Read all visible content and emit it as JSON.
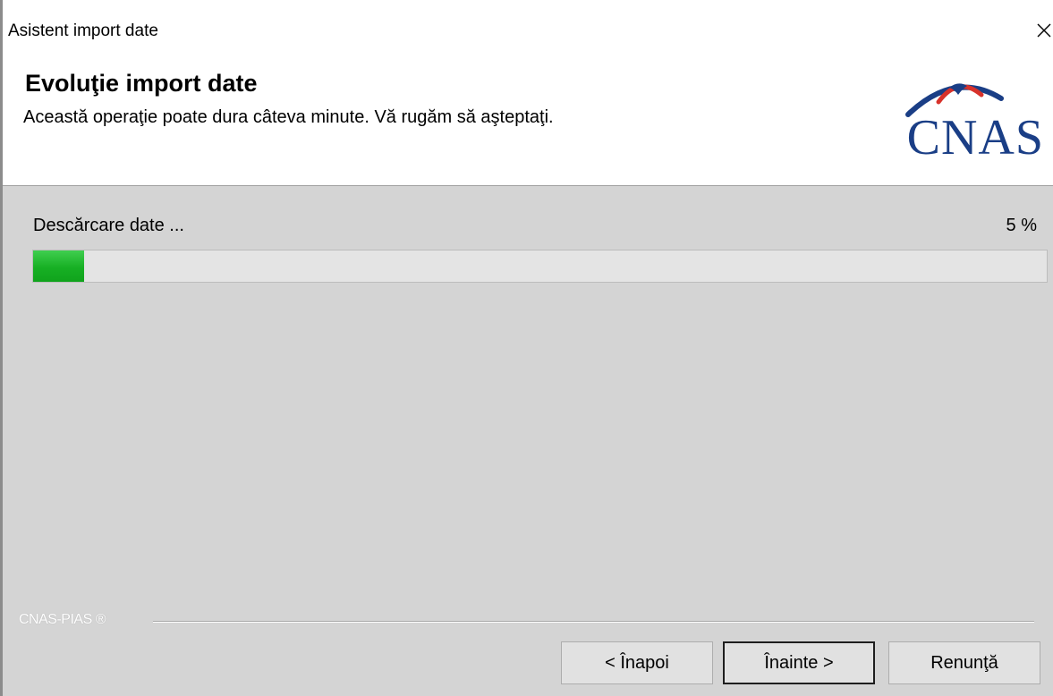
{
  "window": {
    "title": "Asistent import date",
    "close_label": "×"
  },
  "header": {
    "title": "Evoluţie import date",
    "subtitle": "Această operaţie poate dura câteva minute. Vă rugăm să aşteptaţi.",
    "logo_text": "CNAS"
  },
  "progress": {
    "label": "Descărcare date ...",
    "percent_text": "5 %",
    "value": 0.05
  },
  "footer": {
    "brand": "CNAS-PIAS ®"
  },
  "buttons": {
    "back": "< Înapoi",
    "next": "Înainte >",
    "cancel": "Renunţă"
  },
  "colors": {
    "progress_fill": "#17b024",
    "content_bg": "#d4d4d4",
    "logo_blue": "#1a3e86",
    "logo_red": "#d8322b"
  }
}
